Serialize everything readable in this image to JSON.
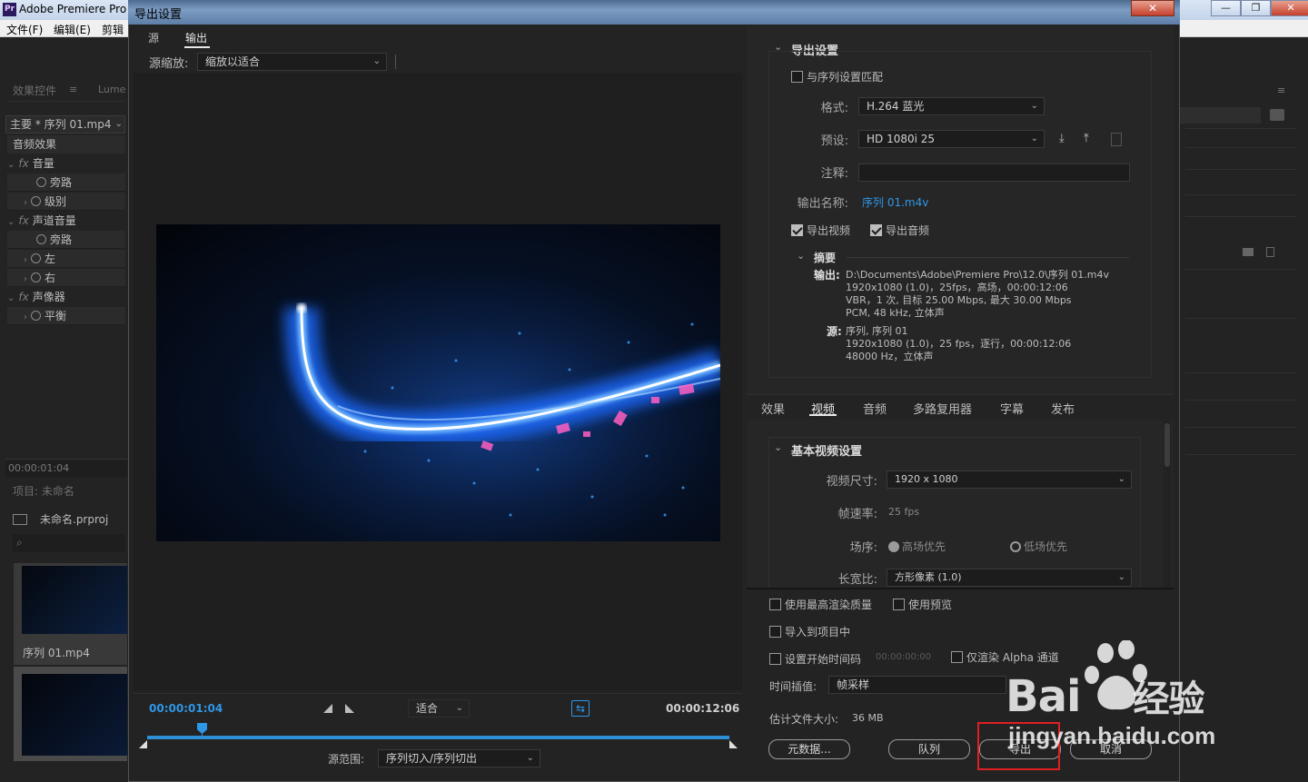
{
  "background_app": {
    "title": "Adobe Premiere Pro",
    "icon_text": "Pr",
    "menu": [
      "文件(F)",
      "编辑(E)",
      "剪辑"
    ],
    "left_panel": {
      "tab_effect_controls": "效果控件",
      "tab_lumetri": "Lume",
      "clip_selector": "主要 * 序列 01.mp4",
      "section_audio": "音频效果",
      "rows": {
        "volume": "音量",
        "bypass1": "旁路",
        "level": "级别",
        "channel_volume": "声道音量",
        "bypass2": "旁路",
        "left": "左",
        "right": "右",
        "panner": "声像器",
        "balance": "平衡"
      },
      "fx_label": "fx",
      "timecode": "00:00:01:04",
      "project_title": "项目: 未命名",
      "project_file": "未命名.prproj",
      "clip_name": "序列 01.mp4"
    }
  },
  "dialog": {
    "title": "导出设置",
    "close_glyph": "✕",
    "preview": {
      "tab_source": "源",
      "tab_output": "输出",
      "scale_label": "源缩放:",
      "scale_value": "缩放以适合",
      "current_time": "00:00:01:04",
      "end_time": "00:00:12:06",
      "fit_value": "适合",
      "range_label": "源范围:",
      "range_value": "序列切入/序列切出"
    },
    "export_settings": {
      "section_title": "导出设置",
      "match_sequence": "与序列设置匹配",
      "format_label": "格式:",
      "format_value": "H.264 蓝光",
      "preset_label": "预设:",
      "preset_value": "HD 1080i 25",
      "comment_label": "注释:",
      "comment_value": "",
      "output_name_label": "输出名称:",
      "output_name_value": "序列 01.m4v",
      "export_video": "导出视频",
      "export_audio": "导出音频",
      "summary_title": "摘要",
      "output_label": "输出:",
      "output_lines": [
        "D:\\Documents\\Adobe\\Premiere Pro\\12.0\\序列 01.m4v",
        "1920x1080 (1.0)，25fps，高场，00:00:12:06",
        "VBR，1 次, 目标 25.00 Mbps, 最大 30.00 Mbps",
        "PCM, 48 kHz, 立体声"
      ],
      "source_label": "源:",
      "source_lines": [
        "序列, 序列 01",
        "1920x1080 (1.0)，25 fps，逐行，00:00:12:06",
        "48000 Hz，立体声"
      ]
    },
    "tabs": [
      "效果",
      "视频",
      "音频",
      "多路复用器",
      "字幕",
      "发布"
    ],
    "video": {
      "section_title": "基本视频设置",
      "frame_size_label": "视频尺寸:",
      "frame_size_value": "1920 x 1080",
      "frame_rate_label": "帧速率:",
      "frame_rate_value": "25 fps",
      "field_order_label": "场序:",
      "field_upper": "高场优先",
      "field_lower": "低场优先",
      "aspect_label": "长宽比:",
      "aspect_value": "方形像素 (1.0)"
    },
    "options": {
      "max_render_quality": "使用最高渲染质量",
      "use_previews": "使用预览",
      "import_into_project": "导入到项目中",
      "set_start_timecode": "设置开始时间码",
      "start_timecode_value": "00:00:00:00",
      "render_alpha_only": "仅渲染 Alpha 通道",
      "time_interpolation_label": "时间插值:",
      "time_interpolation_value": "帧采样",
      "estimated_size_label": "估计文件大小:",
      "estimated_size_value": "36 MB"
    },
    "buttons": {
      "metadata": "元数据...",
      "queue": "队列",
      "export": "导出",
      "cancel": "取消"
    }
  },
  "watermark": {
    "brand": "Bai",
    "brand_cn": "经验",
    "url": "jingyan.baidu.com"
  },
  "colors": {
    "accent_blue": "#2e97e8",
    "highlight_red": "#e02020"
  }
}
